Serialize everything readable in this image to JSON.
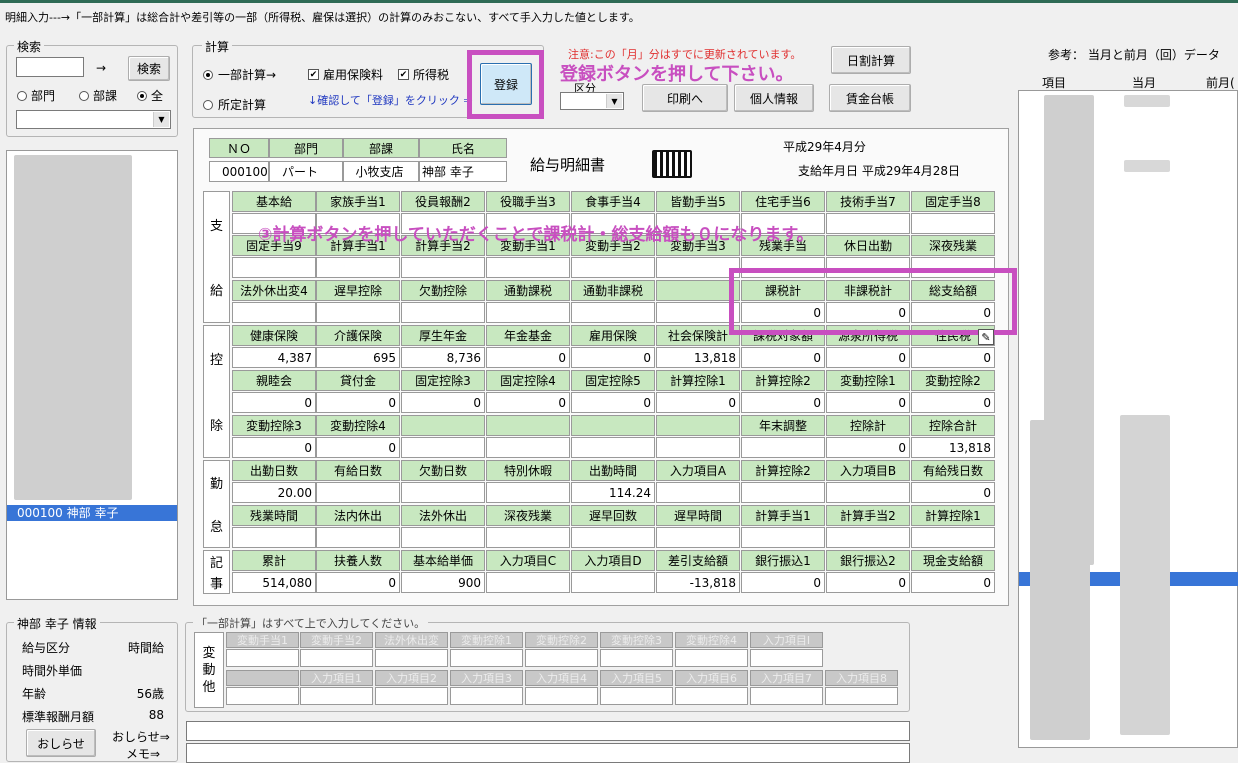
{
  "header": {
    "instruction": "明細入力---→「一部計算」は総合計や差引等の一部（所得税、雇保は選択）の計算のみおこない、すべて手入力した値とします。"
  },
  "search": {
    "group_title": "検索",
    "button": "検索",
    "arrow": "→",
    "radio_bumon": "部門",
    "radio_buka": "部課",
    "radio_all": "全",
    "selected": "全"
  },
  "calc": {
    "group_title": "計算",
    "radio_partial": "一部計算→",
    "radio_fixed": "所定計算",
    "chk_koyou": "雇用保険料",
    "chk_shotoku": "所得税",
    "hint": "↓確認して「登録」をクリック ⇒",
    "register": "登録"
  },
  "notice": {
    "text": "注意:この「月」分はすでに更新されています。",
    "kubun_label": "区分"
  },
  "toolbar": {
    "daily": "日割計算",
    "print": "印刷へ",
    "personal": "個人情報",
    "ledger": "賃金台帳"
  },
  "reference": {
    "title": "参考： 当月と前月（回）データ",
    "col_item": "項目",
    "col_current": "当月",
    "col_prev": "前月("
  },
  "employee_list": {
    "selected": "000100 神部 幸子"
  },
  "slip": {
    "hdr_no": "ＮＯ",
    "hdr_bumon": "部門",
    "hdr_buka": "部課",
    "hdr_name": "氏名",
    "no": "000100",
    "bumon": "パート",
    "buka": "小牧支店",
    "name": "神部 幸子",
    "title": "給与明細書",
    "period": "平成29年4月分",
    "paydate": "支給年月日 平成29年4月28日",
    "sec_shikyu": [
      "支",
      "給"
    ],
    "sec_koujo": [
      "控",
      "除"
    ],
    "sec_kintai": [
      "勤",
      "怠"
    ],
    "sec_kiji": [
      "記",
      "事"
    ],
    "shikyu_r1": [
      "基本給",
      "家族手当1",
      "役員報酬2",
      "役職手当3",
      "食事手当4",
      "皆勤手当5",
      "住宅手当6",
      "技術手当7",
      "固定手当8"
    ],
    "shikyu_r2": [
      "固定手当9",
      "計算手当1",
      "計算手当2",
      "変動手当1",
      "変動手当2",
      "変動手当3",
      "残業手当",
      "休日出勤",
      "深夜残業"
    ],
    "shikyu_r3": [
      "法外休出変4",
      "遅早控除",
      "欠勤控除",
      "通勤課税",
      "通勤非課税",
      "",
      "課税計",
      "非課税計",
      "総支給額"
    ],
    "shikyu_r3_vals": [
      "",
      "",
      "",
      "",
      "",
      "",
      "0",
      "0",
      "0"
    ],
    "koujo_r1": [
      "健康保険",
      "介護保険",
      "厚生年金",
      "年金基金",
      "雇用保険",
      "社会保険計",
      "課税対象額",
      "源泉所得税",
      "住民税"
    ],
    "koujo_r1_vals": [
      "4,387",
      "695",
      "8,736",
      "0",
      "0",
      "13,818",
      "0",
      "0",
      "0"
    ],
    "koujo_r2": [
      "親睦会",
      "貸付金",
      "固定控除3",
      "固定控除4",
      "固定控除5",
      "計算控除1",
      "計算控除2",
      "変動控除1",
      "変動控除2"
    ],
    "koujo_r2_vals": [
      "0",
      "0",
      "0",
      "0",
      "0",
      "0",
      "0",
      "0",
      "0"
    ],
    "koujo_r3": [
      "変動控除3",
      "変動控除4",
      "",
      "",
      "",
      "",
      "年末調整",
      "控除計",
      "控除合計"
    ],
    "koujo_r3_vals": [
      "0",
      "0",
      "",
      "",
      "",
      "",
      "",
      "0",
      "13,818"
    ],
    "kintai_r1": [
      "出勤日数",
      "有給日数",
      "欠勤日数",
      "特別休暇",
      "出勤時間",
      "入力項目A",
      "計算控除2",
      "入力項目B",
      "有給残日数"
    ],
    "kintai_r1_vals": [
      "20.00",
      "",
      "",
      "",
      "114.24",
      "",
      "",
      "",
      "0"
    ],
    "kintai_r2": [
      "残業時間",
      "法内休出",
      "法外休出",
      "深夜残業",
      "遅早回数",
      "遅早時間",
      "計算手当1",
      "計算手当2",
      "計算控除1"
    ],
    "kiji_r1": [
      "累計",
      "扶養人数",
      "基本給単価",
      "入力項目C",
      "入力項目D",
      "差引支給額",
      "銀行振込1",
      "銀行振込2",
      "現金支給額"
    ],
    "kiji_r1_vals": [
      "514,080",
      "0",
      "900",
      "",
      "",
      "-13,818",
      "0",
      "0",
      "0"
    ]
  },
  "info": {
    "group_title": "神部 幸子 情報",
    "rows": [
      {
        "k": "給与区分",
        "v": "時間給"
      },
      {
        "k": "時間外単価",
        "v": ""
      },
      {
        "k": "年齢",
        "v": "56歳"
      },
      {
        "k": "標準報酬月額",
        "v": "88"
      }
    ],
    "notice_btn": "おしらせ",
    "notice_link": "おしらせ⇒",
    "memo_link": "メモ⇒"
  },
  "partial": {
    "group_title": "「一部計算」はすべて上で入力してください。",
    "label": [
      "変",
      "動",
      "他"
    ],
    "r1": [
      "変動手当1",
      "変動手当2",
      "法外休出変",
      "変動控除1",
      "変動控除2",
      "変動控除3",
      "変動控除4",
      "入力項目I"
    ],
    "r2": [
      "",
      "入力項目1",
      "入力項目2",
      "入力項目3",
      "入力項目4",
      "入力項目5",
      "入力項目6",
      "入力項目7",
      "入力項目8"
    ]
  },
  "annotations": {
    "register": "登録ボタンを押して下さい。",
    "step3": "③計算ボタンを押していただくことで課税計・総支給額も０になります。"
  },
  "colors": {
    "accent_pink": "#c84fc0",
    "header_green": "#c8e8c0",
    "selected_blue": "#3875d7"
  }
}
